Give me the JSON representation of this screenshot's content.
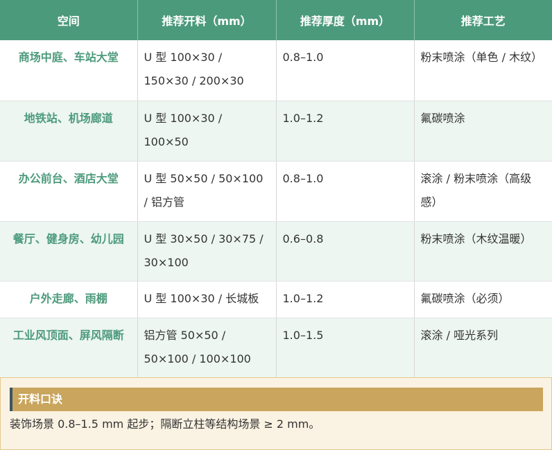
{
  "table": {
    "headers": [
      "空间",
      "推荐开料（mm）",
      "推荐厚度（mm）",
      "推荐工艺"
    ],
    "rows": [
      {
        "space": "商场中庭、车站大堂",
        "material": "U 型 100×30 / 150×30 / 200×30",
        "thickness": "0.8–1.0",
        "process": "粉末喷涂（单色 / 木纹）"
      },
      {
        "space": "地铁站、机场廊道",
        "material": "U 型 100×30 / 100×50",
        "thickness": "1.0–1.2",
        "process": "氟碳喷涂"
      },
      {
        "space": "办公前台、酒店大堂",
        "material": "U 型 50×50 / 50×100 / 铝方管",
        "thickness": "0.8–1.0",
        "process": "滚涂 / 粉末喷涂（高级感）"
      },
      {
        "space": "餐厅、健身房、幼儿园",
        "material": "U 型 30×50 / 30×75 / 30×100",
        "thickness": "0.6–0.8",
        "process": "粉末喷涂（木纹温暖）"
      },
      {
        "space": "户外走廊、雨棚",
        "material": "U 型 100×30 / 长城板",
        "thickness": "1.0–1.2",
        "process": "氟碳喷涂（必须）"
      },
      {
        "space": "工业风顶面、屏风隔断",
        "material": "铝方管 50×50 / 50×100 / 100×100",
        "thickness": "1.0–1.5",
        "process": "滚涂 / 哑光系列"
      }
    ]
  },
  "tip": {
    "title": "开料口诀",
    "text": "装饰场景 0.8–1.5 mm 起步；隔断立柱等结构场景 ≥ 2 mm。"
  },
  "colors": {
    "header_bg": "#4c9a7c",
    "space_text": "#4c9a7c",
    "alt_row_bg": "#edf6f1",
    "tip_bg": "#faf2e2",
    "tip_bar": "#c9a55d"
  }
}
